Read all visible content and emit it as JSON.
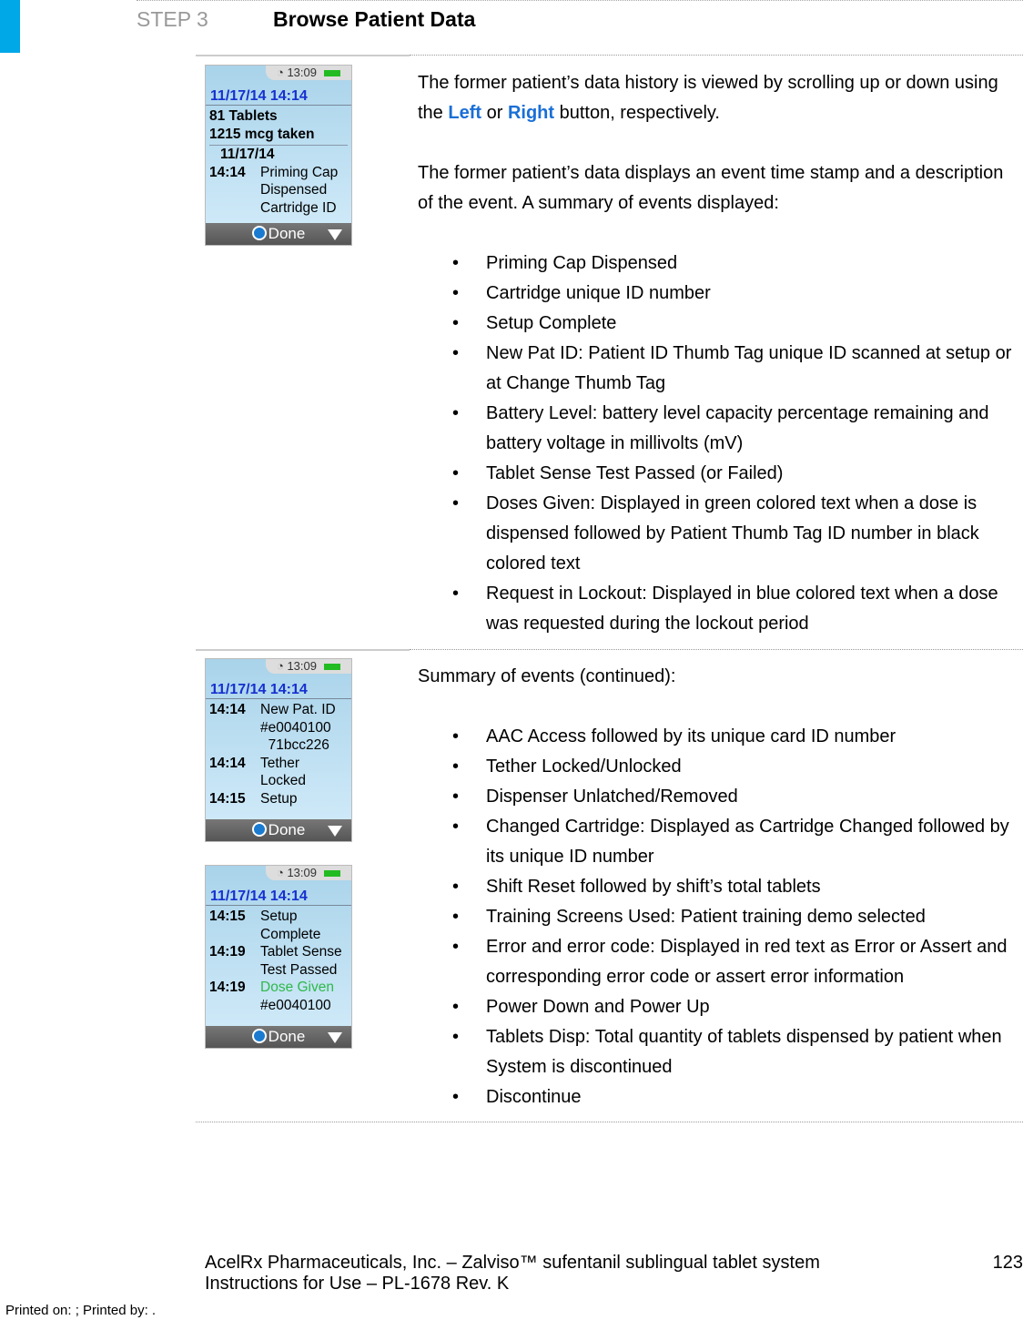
{
  "header": {
    "step": "STEP 3",
    "title": "Browse Patient Data"
  },
  "section1": {
    "p1": [
      "The former patient’s data history is viewed by scrolling up or down using the ",
      "Left",
      " or ",
      "Right",
      " button, respectively."
    ],
    "p2": "The former patient’s data displays an event time stamp and a description of the event.  A summary of events displayed:",
    "bullets": [
      "Priming Cap Dispensed",
      "Cartridge unique ID number",
      "Setup Complete",
      "New Pat ID:  Patient ID Thumb Tag unique ID scanned at setup or at Change Thumb Tag",
      "Battery Level:  battery level capacity percentage remaining and battery voltage in millivolts (mV)",
      "Tablet Sense Test Passed (or Failed)",
      "Doses Given:  Displayed in green colored text when a dose is dispensed followed by Patient Thumb Tag ID number in black colored text",
      "Request in Lockout: Displayed in blue colored text when a dose was requested during the lockout period"
    ]
  },
  "section2": {
    "p1": "Summary of events (continued):",
    "bullets": [
      "AAC Access followed by its unique card ID number",
      "Tether Locked/Unlocked",
      "Dispenser Unlatched/Removed",
      "Changed Cartridge: Displayed as Cartridge Changed followed by its unique ID number",
      "Shift Reset followed by shift’s total tablets",
      "Training Screens Used:  Patient training demo selected",
      "Error and error code:  Displayed in red text as Error or Assert and corresponding error code or assert error information",
      "Power Down and Power Up",
      "Tablets Disp: Total quantity of tablets dispensed by patient when System is discontinued",
      "Discontinue"
    ]
  },
  "devices": [
    {
      "clock": "13:09",
      "date": "11/17/14  14:14",
      "done": "Done",
      "lines": [
        "81 Tablets",
        "1215 mcg taken"
      ],
      "subdate": "11/17/14",
      "rows": [
        {
          "t": "14:14",
          "e": [
            "Priming Cap",
            "Dispensed",
            "Cartridge ID"
          ]
        }
      ]
    },
    {
      "clock": "13:09",
      "date": "11/17/14  14:14",
      "done": "Done",
      "rows": [
        {
          "t": "14:14",
          "e": [
            "New Pat. ID",
            "#e0040100",
            "  71bcc226"
          ]
        },
        {
          "t": "14:14",
          "e": [
            "Tether",
            "Locked"
          ]
        },
        {
          "t": "14:15",
          "e": [
            "Setup"
          ]
        }
      ]
    },
    {
      "clock": "13:09",
      "date": "11/17/14  14:14",
      "done": "Done",
      "rows": [
        {
          "t": "14:15",
          "e": [
            "Setup",
            "Complete"
          ]
        },
        {
          "t": "14:19",
          "e": [
            "Tablet Sense",
            "Test Passed"
          ]
        },
        {
          "t": "14:19",
          "e": [
            "Dose Given",
            "#e0040100"
          ],
          "green": true
        }
      ]
    }
  ],
  "colors": {
    "accent": "#00a8e8",
    "keyword": "#1a6fd6",
    "dose_green": "#2fb84a",
    "screen_date": "#1530d0"
  },
  "footer": {
    "line1": "AcelRx Pharmaceuticals, Inc. – Zalviso™ sufentanil sublingual tablet system",
    "line2": "Instructions for Use – PL-1678 Rev. K",
    "page": "123",
    "printed": "Printed on: ; Printed by: ."
  }
}
